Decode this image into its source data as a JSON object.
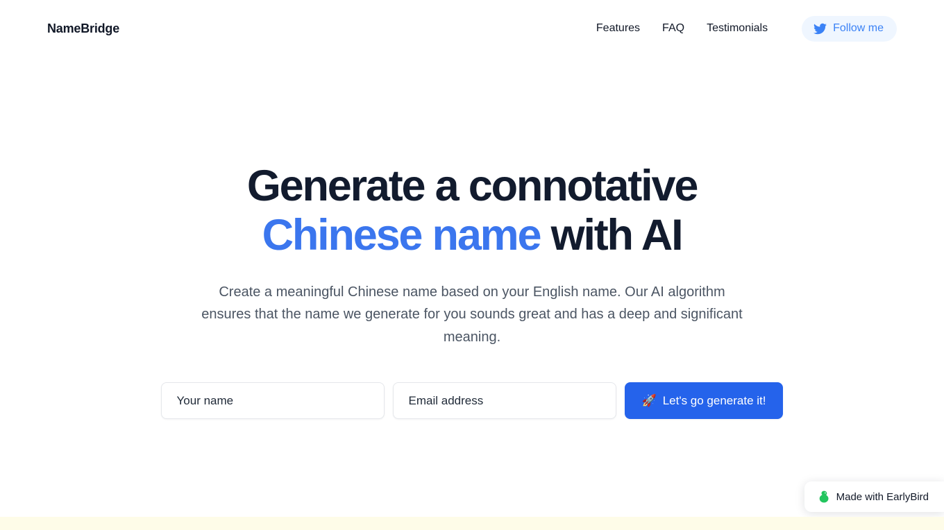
{
  "brand": {
    "name": "NameBridge"
  },
  "nav": {
    "links": [
      {
        "label": "Features"
      },
      {
        "label": "FAQ"
      },
      {
        "label": "Testimonials"
      }
    ],
    "follow": {
      "label": "Follow me",
      "icon": "twitter-icon",
      "color": "#3b82f6",
      "background": "#eff6ff"
    }
  },
  "hero": {
    "headline": {
      "line1": "Generate a connotative",
      "line2_accent": "Chinese name",
      "line2_rest": "with AI",
      "accent_color": "#3b76ee",
      "text_color": "#121b2e"
    },
    "subtitle": "Create a meaningful Chinese name based on your English name. Our AI algorithm ensures that the name we generate for you sounds great and has a deep and significant meaning."
  },
  "form": {
    "name_field": {
      "placeholder": "Your name",
      "value": ""
    },
    "email_field": {
      "placeholder": "Email address",
      "value": ""
    },
    "submit": {
      "emoji": "🚀",
      "label": "Let's go generate it!",
      "background": "#2563eb"
    }
  },
  "earlybird_badge": {
    "label": "Made with EarlyBird",
    "icon": "bird-icon",
    "icon_color": "#22c55e"
  },
  "bottom_strip": {
    "color": "#fefce8"
  }
}
